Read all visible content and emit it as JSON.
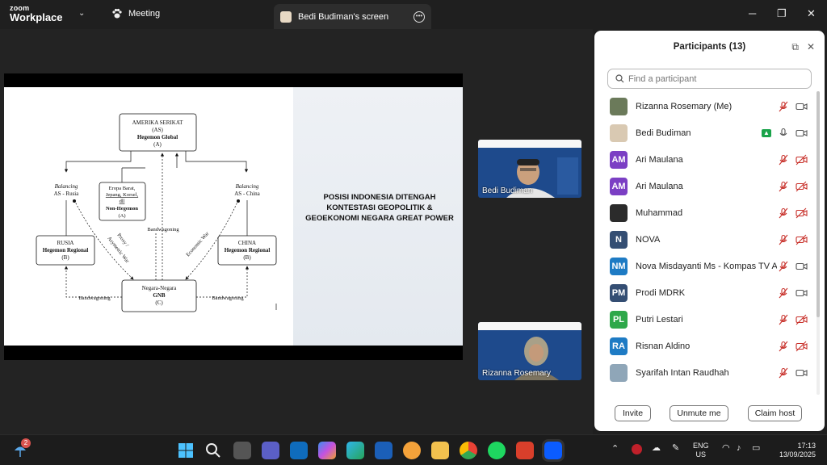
{
  "app": {
    "logo_line1": "zoom",
    "logo_line2": "Workplace"
  },
  "titlebar": {
    "meeting_label": "Meeting",
    "screen_tab_label": "Bedi Budiman's screen",
    "minimize": "─",
    "restore": "❐",
    "close": "✕"
  },
  "slide": {
    "title": "POSISI INDONESIA DITENGAH KONTESTASI GEOPOLITIK & GEOEKONOMI NEGARA GREAT POWER",
    "diagram": {
      "as_l1": "AMERIKA SERIKAT",
      "as_l2": "(AS)",
      "as_l3": "Hegemon Global",
      "as_l4": "(A)",
      "eropa_l1": "Eropa Barat,",
      "eropa_l2": "Jepang, Korsel,",
      "eropa_l3": "dll",
      "eropa_l4": "Non-Hegemon",
      "eropa_l5": "(A)",
      "bal_left_l1": "Balancing",
      "bal_left_l2": "AS - Rusia",
      "bal_right_l1": "Balancing",
      "bal_right_l2": "AS - China",
      "rusia_l1": "RUSIA",
      "rusia_l2": "Hegemon Regional",
      "rusia_l3": "(B)",
      "china_l1": "CHINA",
      "china_l2": "Hegemon Regional",
      "china_l3": "(B)",
      "gnb_l1": "Negara-Negara",
      "gnb_l2": "GNB",
      "gnb_l3": "(C)",
      "bandwagoning_top": "Bandwagoning",
      "bandwagoning_left": "Bandwagoning",
      "bandwagoning_right": "Bandwagoning",
      "proxy": "Proxy /",
      "asym": "Asymetric War",
      "econ": "Economic War"
    }
  },
  "videos": [
    {
      "name": "Bedi Budiman"
    },
    {
      "name": "Rizanna Rosemary"
    }
  ],
  "participants_panel": {
    "title": "Participants (13)",
    "search_placeholder": "Find a participant",
    "participants": [
      {
        "name": "Rizanna Rosemary (Me)",
        "initials": "",
        "color": "#6b7a5a",
        "mic": "muted",
        "video": "on"
      },
      {
        "name": "Bedi Budiman",
        "initials": "",
        "color": "#d9c9b2",
        "mic": "on",
        "video": "on",
        "sharing": true
      },
      {
        "name": "Ari Maulana",
        "initials": "AM",
        "color": "#7b3fc4",
        "mic": "muted",
        "video": "off"
      },
      {
        "name": "Ari Maulana",
        "initials": "AM",
        "color": "#7b3fc4",
        "mic": "muted",
        "video": "off"
      },
      {
        "name": "Muhammad",
        "initials": "",
        "color": "#2b2b2b",
        "mic": "muted",
        "video": "off"
      },
      {
        "name": "NOVA",
        "initials": "N",
        "color": "#344e73",
        "mic": "muted",
        "video": "off"
      },
      {
        "name": "Nova Misdayanti Ms - Kompas TV A...",
        "initials": "NM",
        "color": "#1e7bc4",
        "mic": "muted",
        "video": "on"
      },
      {
        "name": "Prodi MDRK",
        "initials": "PM",
        "color": "#344e73",
        "mic": "muted",
        "video": "on"
      },
      {
        "name": "Putri Lestari",
        "initials": "PL",
        "color": "#2ea84a",
        "mic": "muted",
        "video": "off"
      },
      {
        "name": "Risnan Aldino",
        "initials": "RA",
        "color": "#1e7bc4",
        "mic": "muted",
        "video": "off"
      },
      {
        "name": "Syarifah Intan Raudhah",
        "initials": "",
        "color": "#8fa6b8",
        "mic": "muted",
        "video": "on"
      }
    ],
    "buttons": {
      "invite": "Invite",
      "unmute": "Unmute me",
      "claim_host": "Claim host"
    }
  },
  "taskbar": {
    "weather_badge": "2",
    "lang_l1": "ENG",
    "lang_l2": "US",
    "time": "17:13",
    "date": "13/09/2025"
  }
}
